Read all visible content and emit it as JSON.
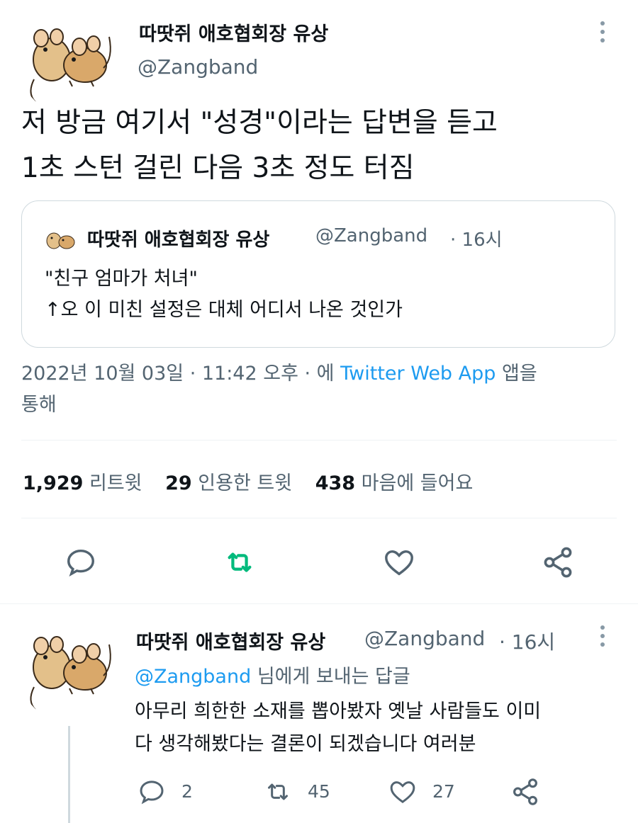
{
  "tweet": {
    "author_name": "따땃쥐 애호협회장 유상",
    "author_handle": "@Zangband",
    "text": "저 방금 여기서 \"성경\"이라는 답변을 듣고\n1초 스턴 걸린 다음 3초 정도 터짐",
    "avatar_icon": "mouse-avatar-icon",
    "quoted": {
      "author_name": "따땃쥐 애호협회장 유상",
      "author_handle": "@Zangband",
      "time": "· 16시",
      "text": "\"친구 엄마가 처녀\"\n↑오 이 미친 설정은 대체 어디서 나온 것인가"
    },
    "meta": {
      "date": "2022년 10월 03일 · 11:42 오후 · 에",
      "source_link": "Twitter Web App",
      "suffix": "앱을",
      "suffix2": "통해"
    },
    "stats": {
      "retweets_count": "1,929",
      "retweets_label": "리트윗",
      "quotes_count": "29",
      "quotes_label": "인용한 트윗",
      "likes_count": "438",
      "likes_label": "마음에 들어요"
    },
    "colors": {
      "retweet_active": "#00ba7c",
      "link": "#1d9bf0",
      "secondary": "#536471"
    }
  },
  "reply": {
    "author_name": "따땃쥐 애호협회장 유상",
    "author_handle": "@Zangband",
    "time": "· 16시",
    "replying_mention": "@Zangband",
    "replying_suffix": "님에게 보내는 답글",
    "text": "아무리 희한한 소재를 뽑아봤자 옛날 사람들도 이미\n다 생각해봤다는 결론이 되겠습니다 여러분",
    "counts": {
      "replies": "2",
      "retweets": "45",
      "likes": "27"
    }
  }
}
